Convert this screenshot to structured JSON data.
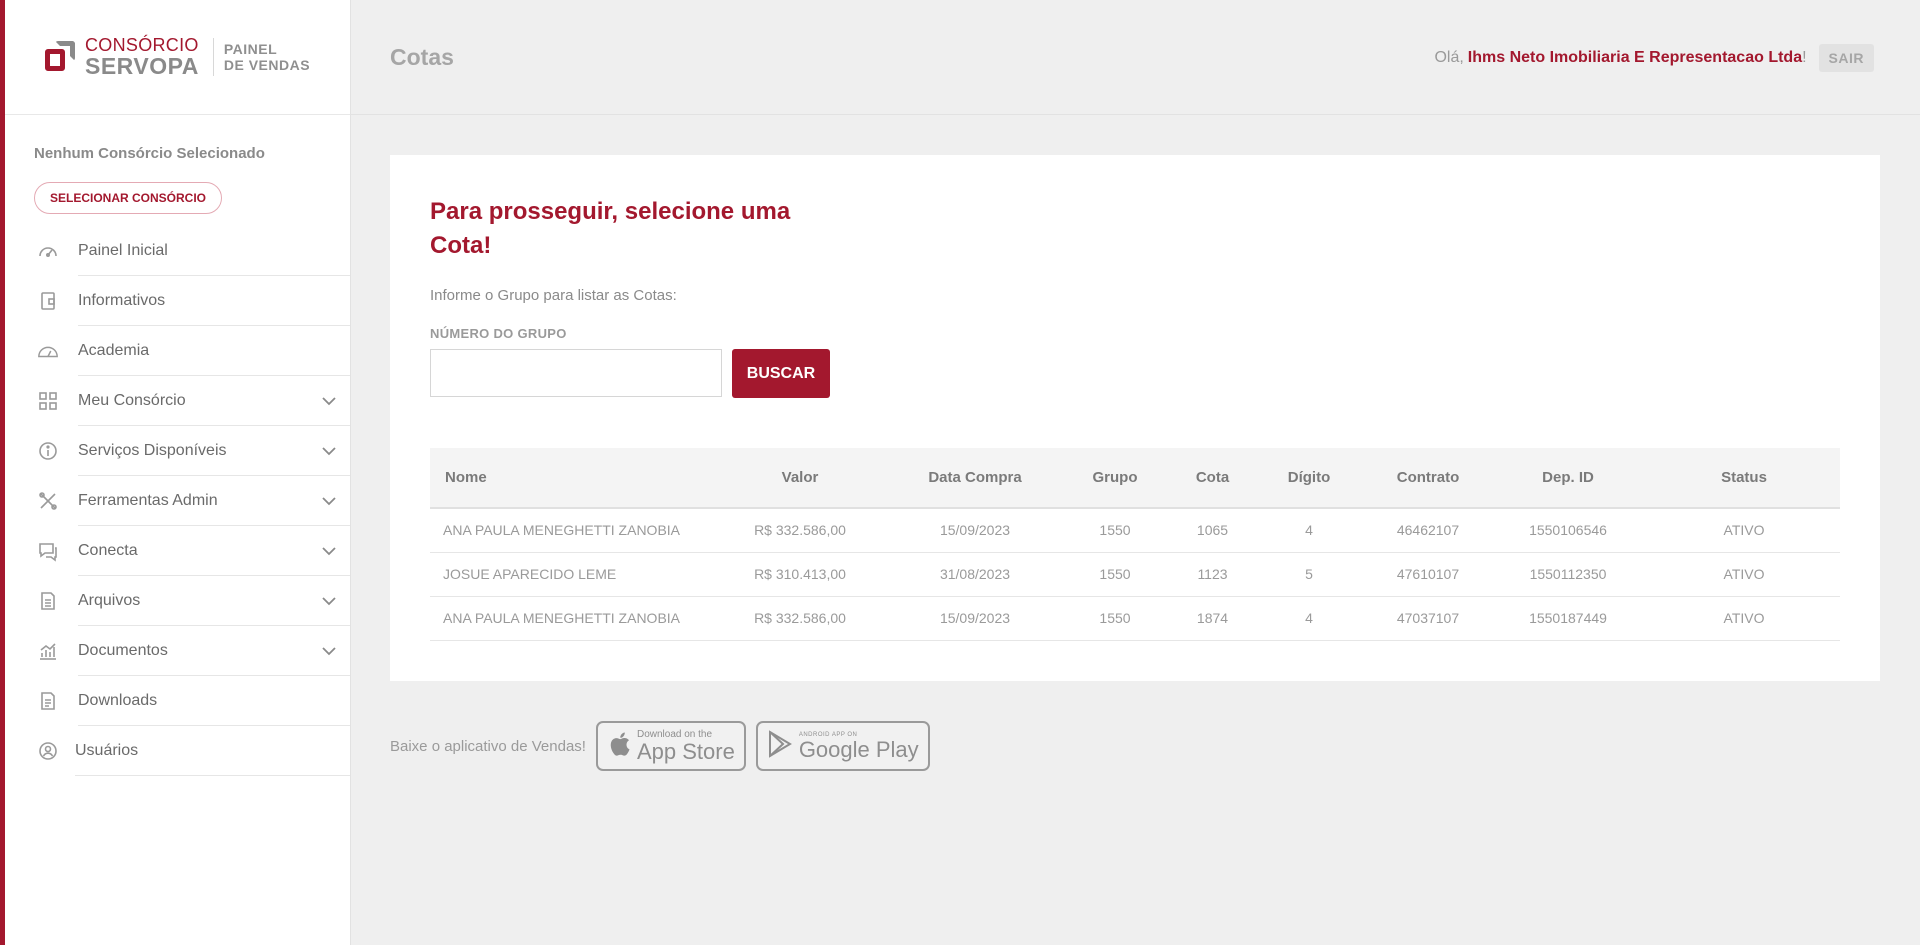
{
  "brand": {
    "line1": "CONSÓRCIO",
    "line2": "SERVOPA",
    "panel_line1": "PAINEL",
    "panel_line2": "DE VENDAS"
  },
  "sidebar": {
    "status": "Nenhum Consórcio Selecionado",
    "select_button": "SELECIONAR CONSÓRCIO",
    "items": [
      {
        "label": "Painel Inicial",
        "icon": "gauge-icon",
        "expandable": false
      },
      {
        "label": "Informativos",
        "icon": "wallet-icon",
        "expandable": false
      },
      {
        "label": "Academia",
        "icon": "dashboard-icon",
        "expandable": false
      },
      {
        "label": "Meu Consórcio",
        "icon": "grid-icon",
        "expandable": true
      },
      {
        "label": "Serviços Disponíveis",
        "icon": "info-icon",
        "expandable": true
      },
      {
        "label": "Ferramentas Admin",
        "icon": "tools-icon",
        "expandable": true
      },
      {
        "label": "Conecta",
        "icon": "chat-icon",
        "expandable": true
      },
      {
        "label": "Arquivos",
        "icon": "file-icon",
        "expandable": true
      },
      {
        "label": "Documentos",
        "icon": "chart-icon",
        "expandable": true
      },
      {
        "label": "Downloads",
        "icon": "document-icon",
        "expandable": false
      },
      {
        "label": "Usuários",
        "icon": "user-icon",
        "expandable": false
      }
    ]
  },
  "header": {
    "title": "Cotas",
    "greeting": "Olá,",
    "user_name": "Ihms Neto Imobiliaria E Representacao Ltda",
    "exclamation": "!",
    "logout": "SAIR"
  },
  "main": {
    "heading": "Para prosseguir, selecione uma Cota!",
    "instruction": "Informe o Grupo para listar as Cotas:",
    "group_label": "NÚMERO DO GRUPO",
    "group_value": "",
    "search_button": "BUSCAR",
    "table": {
      "headers": [
        "Nome",
        "Valor",
        "Data Compra",
        "Grupo",
        "Cota",
        "Dígito",
        "Contrato",
        "Dep. ID",
        "Status"
      ],
      "rows": [
        [
          "ANA PAULA MENEGHETTI ZANOBIA",
          "R$ 332.586,00",
          "15/09/2023",
          "1550",
          "1065",
          "4",
          "46462107",
          "1550106546",
          "ATIVO"
        ],
        [
          "JOSUE APARECIDO LEME",
          "R$ 310.413,00",
          "31/08/2023",
          "1550",
          "1123",
          "5",
          "47610107",
          "1550112350",
          "ATIVO"
        ],
        [
          "ANA PAULA MENEGHETTI ZANOBIA",
          "R$ 332.586,00",
          "15/09/2023",
          "1550",
          "1874",
          "4",
          "47037107",
          "1550187449",
          "ATIVO"
        ]
      ]
    }
  },
  "footer": {
    "promo": "Baixe o aplicativo de Vendas!",
    "app_store_small": "Download on the",
    "app_store_big": "App Store",
    "google_small": "ANDROID APP ON",
    "google_big": "Google Play"
  },
  "colors": {
    "accent": "#a3182e",
    "background": "#efefef",
    "sidebar": "#ffffff"
  }
}
